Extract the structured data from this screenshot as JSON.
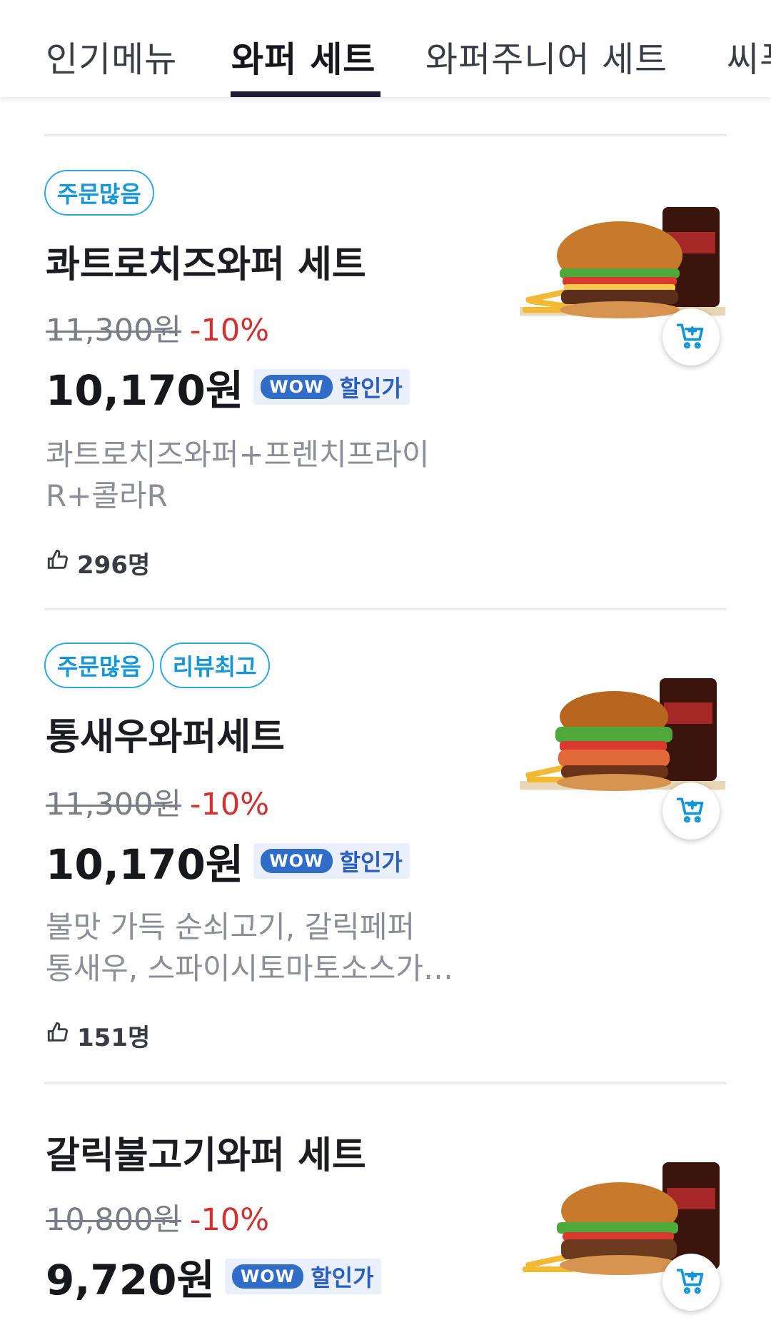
{
  "tabs": [
    {
      "label": "인기메뉴",
      "active": false
    },
    {
      "label": "와퍼 세트",
      "active": true
    },
    {
      "label": "와퍼주니어 세트",
      "active": false
    },
    {
      "label": "씨푸",
      "active": false
    }
  ],
  "items": [
    {
      "badges": [
        "주문많음"
      ],
      "name": "콰트로치즈와퍼 세트",
      "original_price": "11,300원",
      "discount": "-10%",
      "price": "10,170원",
      "wow_label": "WOW",
      "wow_text": "할인가",
      "description_lines": [
        "콰트로치즈와퍼+프렌치프라이",
        "R+콜라R"
      ],
      "likes": "296명",
      "image_icon": "burger-set-image",
      "cart_icon": "add-to-cart-icon"
    },
    {
      "badges": [
        "주문많음",
        "리뷰최고"
      ],
      "name": "통새우와퍼세트",
      "original_price": "11,300원",
      "discount": "-10%",
      "price": "10,170원",
      "wow_label": "WOW",
      "wow_text": "할인가",
      "description_lines": [
        "불맛 가득 순쇠고기, 갈릭페퍼",
        "통새우, 스파이시토마토소스가…"
      ],
      "likes": "151명",
      "image_icon": "burger-set-image",
      "cart_icon": "add-to-cart-icon"
    },
    {
      "badges": [],
      "name": "갈릭불고기와퍼 세트",
      "original_price": "10,800원",
      "discount": "-10%",
      "price": "9,720원",
      "wow_label": "WOW",
      "wow_text": "할인가",
      "image_icon": "burger-set-image",
      "cart_icon": "add-to-cart-icon"
    }
  ],
  "colors": {
    "accent_badge": "#1596d9",
    "discount": "#d4302f",
    "wow": "#2f6dc8",
    "tab_underline": "#1d1c33"
  }
}
